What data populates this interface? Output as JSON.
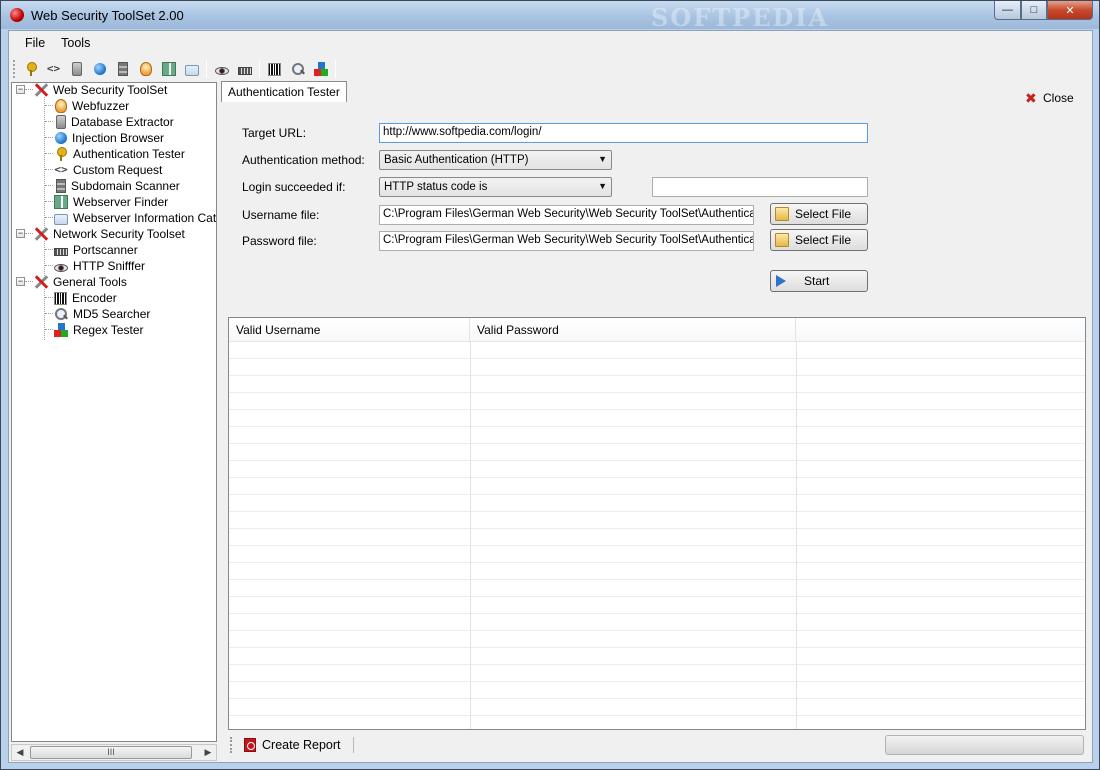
{
  "window": {
    "title": "Web Security ToolSet 2.00",
    "watermark": "SOFTPEDIA"
  },
  "menu": [
    "File",
    "Tools"
  ],
  "toolbar": {
    "icons": [
      "key-icon",
      "code-icon",
      "database-icon",
      "globe-icon",
      "server-icon",
      "bulb-icon",
      "servers-icon",
      "card-icon",
      "eye-icon",
      "ports-icon",
      "barcode-icon",
      "search-icon",
      "blocks-icon"
    ]
  },
  "tree": {
    "groups": [
      {
        "label": "Web Security ToolSet",
        "items": [
          "Webfuzzer",
          "Database Extractor",
          "Injection Browser",
          "Authentication Tester",
          "Custom Request",
          "Subdomain Scanner",
          "Webserver Finder",
          "Webserver Information Catcher"
        ]
      },
      {
        "label": "Network Security Toolset",
        "items": [
          "Portscanner",
          "HTTP Snifffer"
        ]
      },
      {
        "label": "General Tools",
        "items": [
          "Encoder",
          "MD5 Searcher",
          "Regex Tester"
        ]
      }
    ],
    "scroll_thumb": "III"
  },
  "tab": {
    "label": "Authentication Tester"
  },
  "close_label": "Close",
  "form": {
    "target_url_label": "Target URL:",
    "target_url_value": "http://www.softpedia.com/login/",
    "auth_method_label": "Authentication method:",
    "auth_method_value": "Basic Authentication (HTTP)",
    "login_succeeded_label": "Login succeeded if:",
    "login_succeeded_value": "HTTP status code is",
    "login_succeeded_extra": "",
    "username_file_label": "Username file:",
    "username_file_value": "C:\\Program Files\\German Web Security\\Web Security ToolSet\\Authentication",
    "password_file_label": "Password file:",
    "password_file_value": "C:\\Program Files\\German Web Security\\Web Security ToolSet\\Authentication",
    "select_file_label": "Select File",
    "start_label": "Start"
  },
  "results": {
    "columns": [
      "Valid Username",
      "Valid Password",
      ""
    ],
    "rows": []
  },
  "status": {
    "report_label": "Create Report",
    "progress": 0
  },
  "colors": {
    "title_bar": "#a9c4e2",
    "close_button": "#c74a2c",
    "accent_blue": "#2d74c8"
  }
}
